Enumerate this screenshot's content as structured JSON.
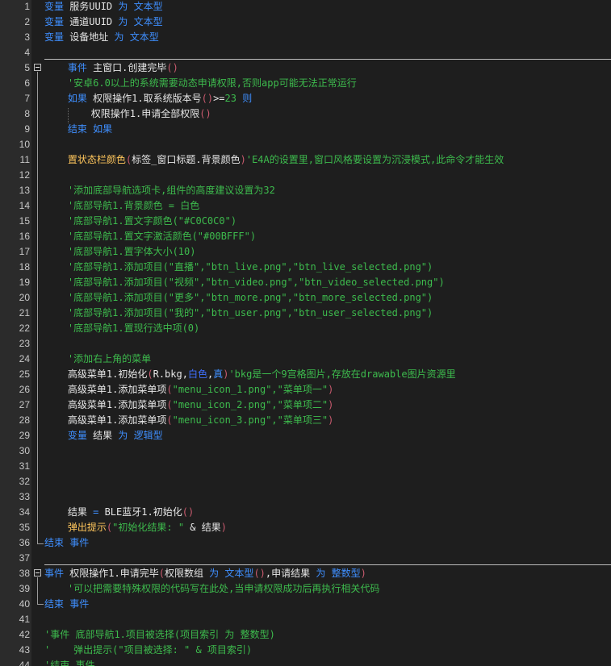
{
  "editor": {
    "lines": [
      {
        "n": "1",
        "tokens": [
          {
            "t": "变量",
            "c": "kw"
          },
          {
            "t": " 服务UUID ",
            "c": "tx"
          },
          {
            "t": "为",
            "c": "kw"
          },
          {
            "t": " ",
            "c": "tx"
          },
          {
            "t": "文本型",
            "c": "ty"
          }
        ]
      },
      {
        "n": "2",
        "tokens": [
          {
            "t": "变量",
            "c": "kw"
          },
          {
            "t": " 通道UUID ",
            "c": "tx"
          },
          {
            "t": "为",
            "c": "kw"
          },
          {
            "t": " ",
            "c": "tx"
          },
          {
            "t": "文本型",
            "c": "ty"
          }
        ]
      },
      {
        "n": "3",
        "tokens": [
          {
            "t": "变量",
            "c": "kw"
          },
          {
            "t": " 设备地址 ",
            "c": "tx"
          },
          {
            "t": "为",
            "c": "kw"
          },
          {
            "t": " ",
            "c": "tx"
          },
          {
            "t": "文本型",
            "c": "ty"
          }
        ]
      },
      {
        "n": "4",
        "tokens": []
      },
      {
        "n": "5",
        "tokens": [
          {
            "t": "    ",
            "c": "tx"
          },
          {
            "t": "事件",
            "c": "kw"
          },
          {
            "t": " 主窗口.创建完毕",
            "c": "tx"
          },
          {
            "t": "()",
            "c": "pn"
          }
        ]
      },
      {
        "n": "6",
        "tokens": [
          {
            "t": "    ",
            "c": "tx"
          },
          {
            "t": "'安卓6.0以上的系统需要动态申请权限,否则app可能无法正常运行",
            "c": "cm"
          }
        ]
      },
      {
        "n": "7",
        "tokens": [
          {
            "t": "    ",
            "c": "tx"
          },
          {
            "t": "如果",
            "c": "kw"
          },
          {
            "t": " 权限操作1.取系统版本号",
            "c": "tx"
          },
          {
            "t": "()",
            "c": "pn"
          },
          {
            "t": ">=",
            "c": "tx"
          },
          {
            "t": "23",
            "c": "num"
          },
          {
            "t": " ",
            "c": "tx"
          },
          {
            "t": "则",
            "c": "kw"
          }
        ]
      },
      {
        "n": "8",
        "tokens": [
          {
            "t": "        权限操作1.申请全部权限",
            "c": "tx"
          },
          {
            "t": "()",
            "c": "pn"
          }
        ]
      },
      {
        "n": "9",
        "tokens": [
          {
            "t": "    ",
            "c": "tx"
          },
          {
            "t": "结束 如果",
            "c": "kw"
          }
        ]
      },
      {
        "n": "10",
        "tokens": []
      },
      {
        "n": "11",
        "tokens": [
          {
            "t": "    ",
            "c": "tx"
          },
          {
            "t": "置状态栏颜色",
            "c": "fn"
          },
          {
            "t": "(",
            "c": "pn"
          },
          {
            "t": "标签_窗口标题.背景颜色",
            "c": "tx"
          },
          {
            "t": ")",
            "c": "pn"
          },
          {
            "t": "'E4A的设置里,窗口风格要设置为沉浸模式,此命令才能生效",
            "c": "cm"
          }
        ]
      },
      {
        "n": "12",
        "tokens": []
      },
      {
        "n": "13",
        "tokens": [
          {
            "t": "    ",
            "c": "tx"
          },
          {
            "t": "'添加底部导航选项卡,组件的高度建议设置为32",
            "c": "cm"
          }
        ]
      },
      {
        "n": "14",
        "tokens": [
          {
            "t": "    ",
            "c": "tx"
          },
          {
            "t": "'底部导航1.背景颜色 = 白色",
            "c": "cm"
          }
        ]
      },
      {
        "n": "15",
        "tokens": [
          {
            "t": "    ",
            "c": "tx"
          },
          {
            "t": "'底部导航1.置文字颜色(\"#C0C0C0\")",
            "c": "cm"
          }
        ]
      },
      {
        "n": "16",
        "tokens": [
          {
            "t": "    ",
            "c": "tx"
          },
          {
            "t": "'底部导航1.置文字激活颜色(\"#00BFFF\")",
            "c": "cm"
          }
        ]
      },
      {
        "n": "17",
        "tokens": [
          {
            "t": "    ",
            "c": "tx"
          },
          {
            "t": "'底部导航1.置字体大小(10)",
            "c": "cm"
          }
        ]
      },
      {
        "n": "18",
        "tokens": [
          {
            "t": "    ",
            "c": "tx"
          },
          {
            "t": "'底部导航1.添加项目(\"直播\",\"btn_live.png\",\"btn_live_selected.png\")",
            "c": "cm"
          }
        ]
      },
      {
        "n": "19",
        "tokens": [
          {
            "t": "    ",
            "c": "tx"
          },
          {
            "t": "'底部导航1.添加项目(\"视频\",\"btn_video.png\",\"btn_video_selected.png\")",
            "c": "cm"
          }
        ]
      },
      {
        "n": "20",
        "tokens": [
          {
            "t": "    ",
            "c": "tx"
          },
          {
            "t": "'底部导航1.添加项目(\"更多\",\"btn_more.png\",\"btn_more_selected.png\")",
            "c": "cm"
          }
        ]
      },
      {
        "n": "21",
        "tokens": [
          {
            "t": "    ",
            "c": "tx"
          },
          {
            "t": "'底部导航1.添加项目(\"我的\",\"btn_user.png\",\"btn_user_selected.png\")",
            "c": "cm"
          }
        ]
      },
      {
        "n": "22",
        "tokens": [
          {
            "t": "    ",
            "c": "tx"
          },
          {
            "t": "'底部导航1.置现行选中项(0)",
            "c": "cm"
          }
        ]
      },
      {
        "n": "23",
        "tokens": []
      },
      {
        "n": "24",
        "tokens": [
          {
            "t": "    ",
            "c": "tx"
          },
          {
            "t": "'添加右上角的菜单",
            "c": "cm"
          }
        ]
      },
      {
        "n": "25",
        "tokens": [
          {
            "t": "    高级菜单1.初始化",
            "c": "tx"
          },
          {
            "t": "(",
            "c": "pn"
          },
          {
            "t": "R.bkg,",
            "c": "tx"
          },
          {
            "t": "白色",
            "c": "hl"
          },
          {
            "t": ",",
            "c": "tx"
          },
          {
            "t": "真",
            "c": "kw"
          },
          {
            "t": ")",
            "c": "pn"
          },
          {
            "t": "'bkg是一个9宫格图片,存放在drawable图片资源里",
            "c": "cm"
          }
        ]
      },
      {
        "n": "26",
        "tokens": [
          {
            "t": "    高级菜单1.添加菜单项",
            "c": "tx"
          },
          {
            "t": "(",
            "c": "pn"
          },
          {
            "t": "\"menu_icon_1.png\",\"菜单项一\"",
            "c": "str"
          },
          {
            "t": ")",
            "c": "pn"
          }
        ]
      },
      {
        "n": "27",
        "tokens": [
          {
            "t": "    高级菜单1.添加菜单项",
            "c": "tx"
          },
          {
            "t": "(",
            "c": "pn"
          },
          {
            "t": "\"menu_icon_2.png\",\"菜单项二\"",
            "c": "str"
          },
          {
            "t": ")",
            "c": "pn"
          }
        ]
      },
      {
        "n": "28",
        "tokens": [
          {
            "t": "    高级菜单1.添加菜单项",
            "c": "tx"
          },
          {
            "t": "(",
            "c": "pn"
          },
          {
            "t": "\"menu_icon_3.png\",\"菜单项三\"",
            "c": "str"
          },
          {
            "t": ")",
            "c": "pn"
          }
        ]
      },
      {
        "n": "29",
        "tokens": [
          {
            "t": "    ",
            "c": "tx"
          },
          {
            "t": "变量",
            "c": "kw"
          },
          {
            "t": " 结果 ",
            "c": "tx"
          },
          {
            "t": "为",
            "c": "kw"
          },
          {
            "t": " ",
            "c": "tx"
          },
          {
            "t": "逻辑型",
            "c": "ty"
          }
        ]
      },
      {
        "n": "30",
        "tokens": []
      },
      {
        "n": "31",
        "tokens": []
      },
      {
        "n": "32",
        "tokens": []
      },
      {
        "n": "33",
        "tokens": []
      },
      {
        "n": "34",
        "tokens": [
          {
            "t": "    结果 ",
            "c": "tx"
          },
          {
            "t": "=",
            "c": "kw"
          },
          {
            "t": " BLE蓝牙1.初始化",
            "c": "tx"
          },
          {
            "t": "()",
            "c": "pn"
          }
        ]
      },
      {
        "n": "35",
        "tokens": [
          {
            "t": "    ",
            "c": "tx"
          },
          {
            "t": "弹出提示",
            "c": "fn"
          },
          {
            "t": "(",
            "c": "pn"
          },
          {
            "t": "\"初始化结果: \"",
            "c": "str"
          },
          {
            "t": " & 结果",
            "c": "tx"
          },
          {
            "t": ")",
            "c": "pn"
          }
        ]
      },
      {
        "n": "36",
        "tokens": [
          {
            "t": "结束 事件",
            "c": "kw"
          }
        ]
      },
      {
        "n": "37",
        "tokens": []
      },
      {
        "n": "38",
        "tokens": [
          {
            "t": "事件",
            "c": "kw"
          },
          {
            "t": " 权限操作1.申请完毕",
            "c": "tx"
          },
          {
            "t": "(",
            "c": "pn"
          },
          {
            "t": "权限数组 ",
            "c": "tx"
          },
          {
            "t": "为",
            "c": "kw"
          },
          {
            "t": " ",
            "c": "tx"
          },
          {
            "t": "文本型",
            "c": "ty"
          },
          {
            "t": "()",
            "c": "pn"
          },
          {
            "t": ",申请结果 ",
            "c": "tx"
          },
          {
            "t": "为",
            "c": "kw"
          },
          {
            "t": " ",
            "c": "tx"
          },
          {
            "t": "整数型",
            "c": "ty"
          },
          {
            "t": ")",
            "c": "pn"
          }
        ]
      },
      {
        "n": "39",
        "tokens": [
          {
            "t": "    ",
            "c": "tx"
          },
          {
            "t": "'可以把需要特殊权限的代码写在此处,当申请权限成功后再执行相关代码",
            "c": "cm"
          }
        ]
      },
      {
        "n": "40",
        "tokens": [
          {
            "t": "结束 事件",
            "c": "kw"
          }
        ]
      },
      {
        "n": "41",
        "tokens": []
      },
      {
        "n": "42",
        "tokens": [
          {
            "t": "'事件 底部导航1.项目被选择(项目索引 为 整数型)",
            "c": "cm"
          }
        ]
      },
      {
        "n": "43",
        "tokens": [
          {
            "t": "'    弹出提示(\"项目被选择: \" & 项目索引)",
            "c": "cm"
          }
        ]
      },
      {
        "n": "44",
        "tokens": [
          {
            "t": "'结束 事件",
            "c": "cm"
          }
        ]
      }
    ]
  }
}
